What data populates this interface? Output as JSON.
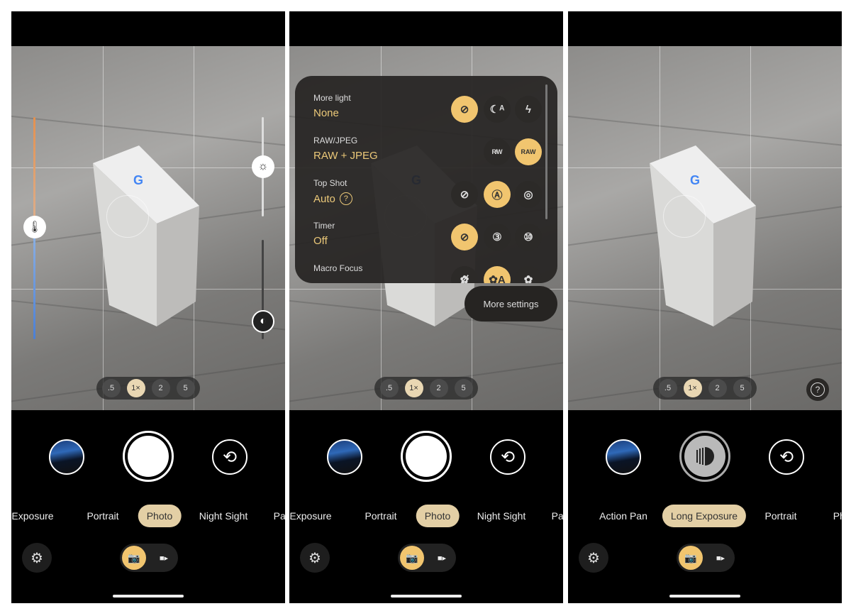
{
  "colors": {
    "accent": "#f1c56f",
    "mode_selected": "#e3cfa5",
    "zoom_selected": "#e9d7b3"
  },
  "screens": [
    {
      "zoom_levels": [
        ".5",
        "1×",
        "2",
        "5"
      ],
      "zoom_selected": 1,
      "modes": [
        "Exposure",
        "Portrait",
        "Photo",
        "Night Sight",
        "Pano"
      ],
      "mode_selected": 2,
      "shutter": "photo",
      "settings_icon": "gear-camera-icon",
      "sliders": [
        {
          "name": "white-balance",
          "icon": "thermometer-icon"
        },
        {
          "name": "brightness",
          "icon": "sun-icon"
        },
        {
          "name": "contrast",
          "icon": "contrast-icon"
        }
      ]
    },
    {
      "zoom_levels": [
        ".5",
        "1×",
        "2",
        "5"
      ],
      "zoom_selected": 1,
      "modes": [
        "Exposure",
        "Portrait",
        "Photo",
        "Night Sight",
        "Pano"
      ],
      "mode_selected": 2,
      "shutter": "photo",
      "settings_icon": "gear-camera-icon",
      "quick_settings": [
        {
          "label": "More light",
          "value": "None",
          "options": [
            {
              "icon": "no-flash-icon",
              "glyph": "⊘",
              "selected": true
            },
            {
              "icon": "night-auto-icon",
              "glyph": "☾ᴬ",
              "selected": false
            },
            {
              "icon": "flash-icon",
              "glyph": "ϟ",
              "selected": false
            }
          ]
        },
        {
          "label": "RAW/JPEG",
          "value": "RAW + JPEG",
          "options": [
            {
              "icon": "raw-off-icon",
              "glyph": "R̸W",
              "selected": false
            },
            {
              "icon": "raw-icon",
              "glyph": "RAW",
              "selected": true
            }
          ]
        },
        {
          "label": "Top Shot",
          "value": "Auto",
          "help": "?",
          "options": [
            {
              "icon": "top-shot-off-icon",
              "glyph": "⊘",
              "selected": false
            },
            {
              "icon": "top-shot-auto-icon",
              "glyph": "Ⓐ",
              "selected": true
            },
            {
              "icon": "top-shot-on-icon",
              "glyph": "◎",
              "selected": false
            }
          ]
        },
        {
          "label": "Timer",
          "value": "Off",
          "options": [
            {
              "icon": "timer-off-icon",
              "glyph": "⊘",
              "selected": true
            },
            {
              "icon": "timer-3-icon",
              "glyph": "③",
              "selected": false
            },
            {
              "icon": "timer-10-icon",
              "glyph": "⑩",
              "selected": false
            }
          ]
        },
        {
          "label": "Macro Focus",
          "value": "",
          "options": [
            {
              "icon": "macro-off-icon",
              "glyph": "✿̸",
              "selected": false
            },
            {
              "icon": "macro-auto-icon",
              "glyph": "✿A",
              "selected": true
            },
            {
              "icon": "macro-on-icon",
              "glyph": "✿",
              "selected": false
            }
          ]
        }
      ],
      "more_settings": "More settings"
    },
    {
      "zoom_levels": [
        ".5",
        "1×",
        "2",
        "5"
      ],
      "zoom_selected": 1,
      "modes": [
        "Action Pan",
        "Long Exposure",
        "Portrait",
        "Photo"
      ],
      "mode_selected": 1,
      "shutter": "long-exposure",
      "settings_icon": "gear-long-exposure-icon",
      "help": "?"
    }
  ]
}
